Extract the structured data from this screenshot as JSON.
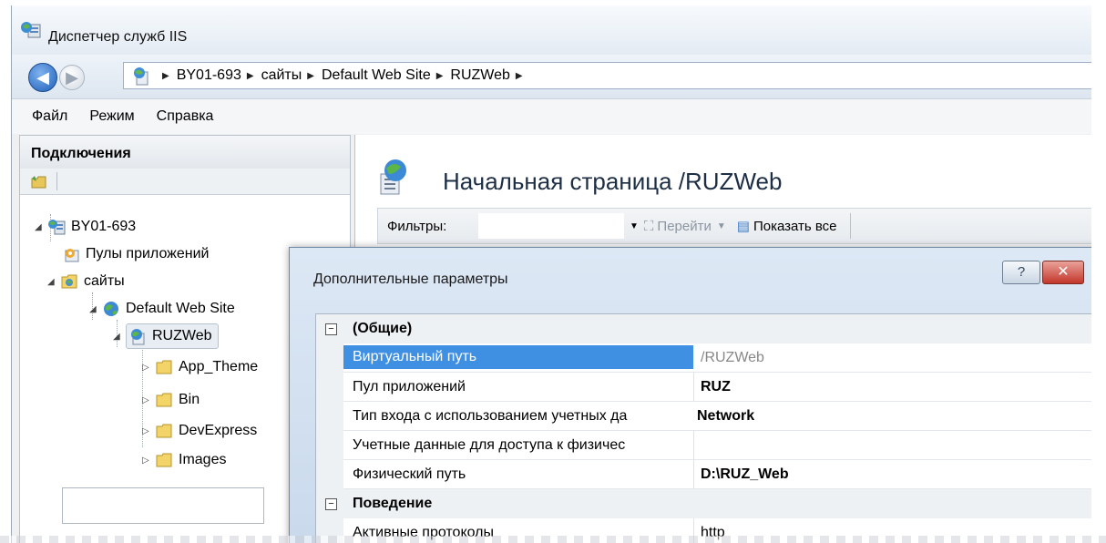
{
  "window": {
    "title": "Диспетчер служб IIS"
  },
  "address": {
    "crumbs": [
      "BY01-693",
      "сайты",
      "Default Web Site",
      "RUZWeb",
      ""
    ]
  },
  "menu": [
    "Файл",
    "Режим",
    "Справка"
  ],
  "connections": {
    "header": "Подключения",
    "tree": {
      "server": "BY01-693",
      "app_pools": "Пулы приложений",
      "sites": "сайты",
      "default_site": "Default Web Site",
      "app": "RUZWeb",
      "folders": [
        "App_Theme",
        "Bin",
        "DevExpress",
        "Images"
      ]
    }
  },
  "main": {
    "title": "Начальная страница /RUZWeb",
    "filter_label": "Фильтры:",
    "go_label": "Перейти",
    "show_all_label": "Показать все"
  },
  "dialog": {
    "title": "Дополнительные параметры",
    "help": "?",
    "close": "✕",
    "categories": [
      {
        "name": "(Общие)",
        "toggle": "⊟",
        "properties": [
          {
            "name": "Виртуальный путь",
            "value": "/RUZWeb"
          },
          {
            "name": "Пул приложений",
            "value": "RUZ"
          },
          {
            "name": "Тип входа с использованием учетных да",
            "value": "Network"
          },
          {
            "name": "Учетные данные для доступа к физичес",
            "value": ""
          },
          {
            "name": "Физический путь",
            "value": "D:\\RUZ_Web"
          }
        ]
      },
      {
        "name": "Поведение",
        "toggle": "⊟",
        "properties": [
          {
            "name": "Активные протоколы",
            "value": "http"
          }
        ]
      }
    ]
  },
  "colors": {
    "selection": "#3f8fe3",
    "close_button": "#c3362a",
    "title_text": "#1e2f45"
  }
}
